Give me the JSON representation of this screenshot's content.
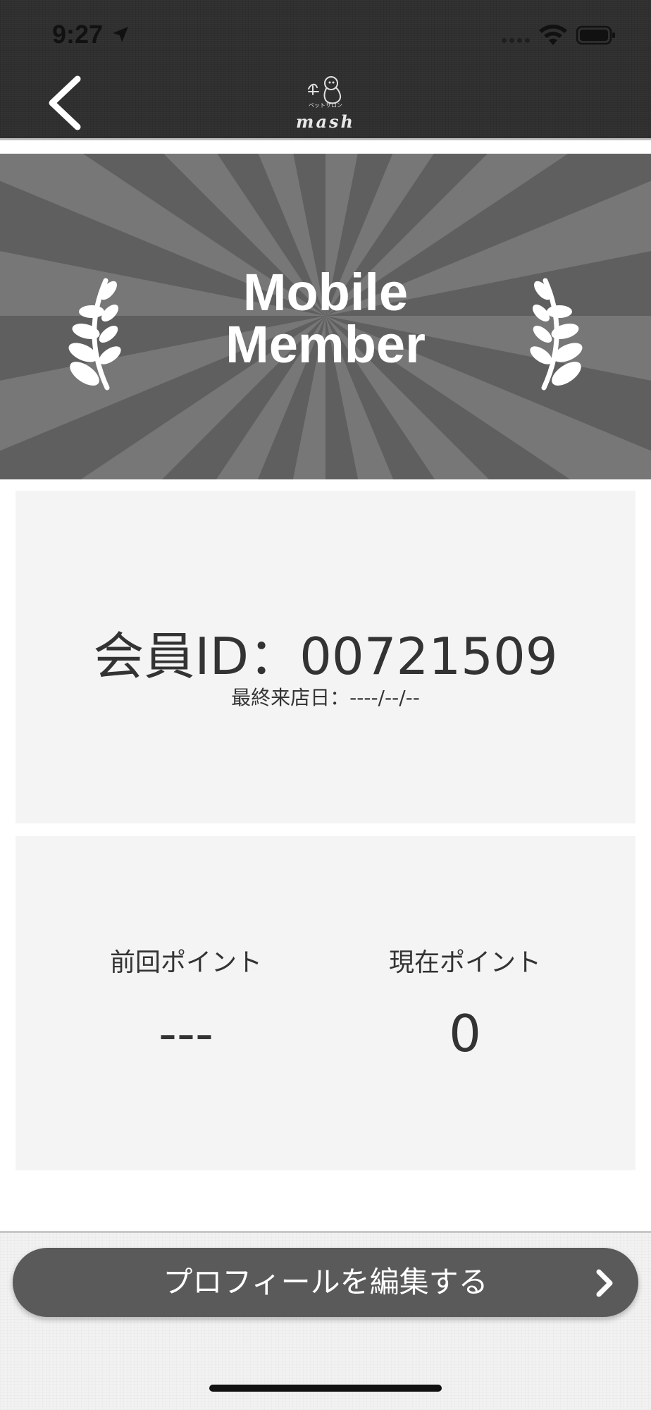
{
  "status_bar": {
    "time": "9:27"
  },
  "header": {
    "back_icon": "chevron-left-icon",
    "logo_kana": "ペットサロン",
    "logo_text": "mash"
  },
  "banner": {
    "line1": "Mobile",
    "line2": "Member",
    "background_color": "#5f5f5f",
    "ray_color": "#777777"
  },
  "member": {
    "id_line": "会員ID：00721509",
    "last_visit": "最終来店日：----/--/--"
  },
  "points": {
    "previous_label": "前回ポイント",
    "previous_value": "---",
    "current_label": "現在ポイント",
    "current_value": "0"
  },
  "actions": {
    "edit_profile_label": "プロフィールを編集する",
    "edit_profile_icon": "chevron-right-icon"
  },
  "colors": {
    "header_bg": "#2f2f2f",
    "card_bg": "#f4f4f4",
    "button_bg": "#5a5a5a",
    "text": "#333333"
  }
}
